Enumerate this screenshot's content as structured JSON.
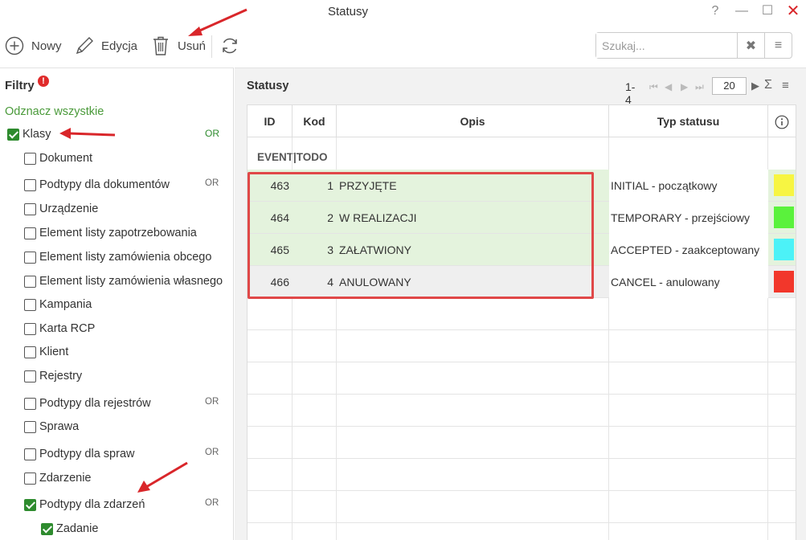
{
  "window": {
    "title": "Statusy",
    "help": "?",
    "minimize": "—",
    "maximize": "☐",
    "close": "✕"
  },
  "toolbar": {
    "new_label": "Nowy",
    "edit_label": "Edycja",
    "delete_label": "Usuń"
  },
  "search": {
    "placeholder": "Szukaj..."
  },
  "filters": {
    "title": "Filtry",
    "uncheck_all": "Odznacz wszystkie",
    "items": [
      {
        "label": "Klasy",
        "checked": true,
        "or": "OR"
      },
      {
        "label": "Dokument",
        "checked": false,
        "or": ""
      },
      {
        "label": "Podtypy dla dokumentów",
        "checked": false,
        "or": "OR"
      },
      {
        "label": "Urządzenie",
        "checked": false,
        "or": ""
      },
      {
        "label": "Element listy zapotrzebowania",
        "checked": false,
        "or": ""
      },
      {
        "label": "Element listy zamówienia obcego",
        "checked": false,
        "or": ""
      },
      {
        "label": "Element listy zamówienia własnego",
        "checked": false,
        "or": ""
      },
      {
        "label": "Kampania",
        "checked": false,
        "or": ""
      },
      {
        "label": "Karta RCP",
        "checked": false,
        "or": ""
      },
      {
        "label": "Klient",
        "checked": false,
        "or": ""
      },
      {
        "label": "Rejestry",
        "checked": false,
        "or": ""
      },
      {
        "label": "Podtypy dla rejestrów",
        "checked": false,
        "or": "OR"
      },
      {
        "label": "Sprawa",
        "checked": false,
        "or": ""
      },
      {
        "label": "Podtypy dla spraw",
        "checked": false,
        "or": "OR"
      },
      {
        "label": "Zdarzenie",
        "checked": false,
        "or": ""
      },
      {
        "label": "Podtypy dla zdarzeń",
        "checked": true,
        "or": "OR"
      },
      {
        "label": "Zadanie",
        "checked": true,
        "or": ""
      }
    ]
  },
  "statuses": {
    "title": "Statusy",
    "pager_range": "1-4",
    "page_size": "20",
    "columns": {
      "id": "ID",
      "kod": "Kod",
      "opis": "Opis",
      "typ": "Typ statusu",
      "info": "i"
    },
    "group": "EVENT|TODO",
    "rows": [
      {
        "id": "463",
        "kod": "1",
        "opis": "PRZYJĘTE",
        "typ": "INITIAL - początkowy",
        "color": "#f7f542"
      },
      {
        "id": "464",
        "kod": "2",
        "opis": "W REALIZACJI",
        "typ": "TEMPORARY - przejściowy",
        "color": "#5af23c"
      },
      {
        "id": "465",
        "kod": "3",
        "opis": "ZAŁATWIONY",
        "typ": "ACCEPTED - zaakceptowany",
        "color": "#4cf2f7"
      },
      {
        "id": "466",
        "kod": "4",
        "opis": "ANULOWANY",
        "typ": "CANCEL - anulowany",
        "color": "#f2372b"
      }
    ]
  }
}
